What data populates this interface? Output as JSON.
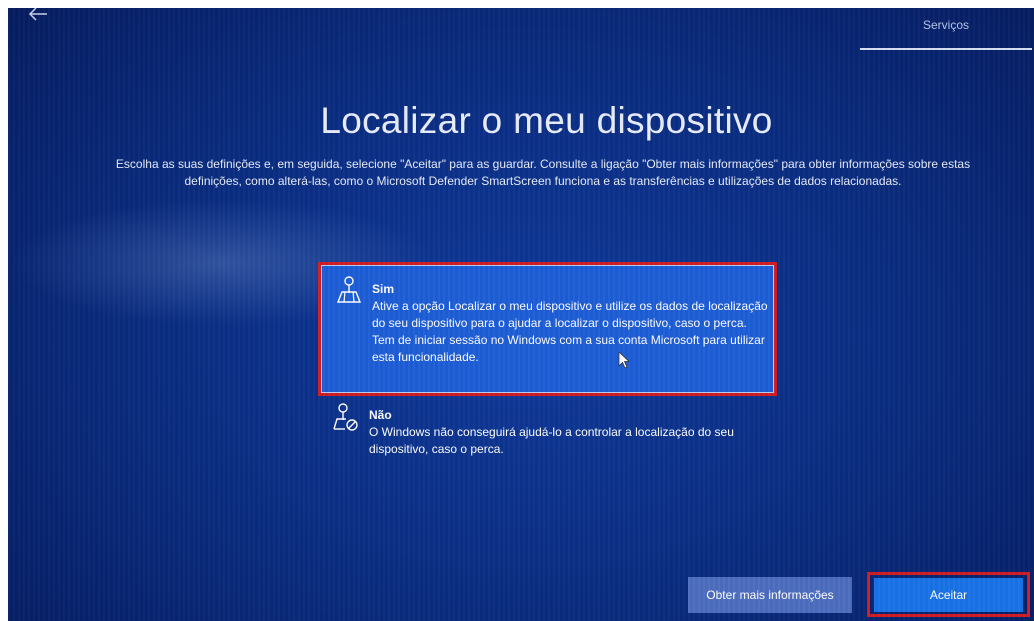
{
  "header": {
    "back_icon": "back-arrow-icon",
    "tab_label": "Serviços"
  },
  "page": {
    "title": "Localizar o meu dispositivo",
    "description": "Escolha as suas definições e, em seguida, selecione \"Aceitar\" para as guardar. Consulte a ligação \"Obter mais informações\" para obter informações sobre estas definições, como alterá-las, como o Microsoft Defender SmartScreen funciona e as transferências e utilizações de dados relacionadas."
  },
  "options": [
    {
      "icon": "location-map-icon",
      "title": "Sim",
      "text": "Ative a opção Localizar o meu dispositivo e utilize os dados de localização do seu dispositivo para o ajudar a localizar o dispositivo, caso o perca. Tem de iniciar sessão no Windows com a sua conta Microsoft para utilizar esta funcionalidade.",
      "selected": true
    },
    {
      "icon": "location-disabled-icon",
      "title": "Não",
      "text": "O Windows não conseguirá ajudá-lo a controlar a localização do seu dispositivo, caso o perca.",
      "selected": false
    }
  ],
  "buttons": {
    "more_info": "Obter mais informações",
    "accept": "Aceitar"
  },
  "colors": {
    "background": "#0b2f86",
    "selected_option": "#1e5ed8",
    "highlight_border": "#d21c24",
    "accept_button": "#1a73e8",
    "more_info_button": "#4d6ec0"
  }
}
